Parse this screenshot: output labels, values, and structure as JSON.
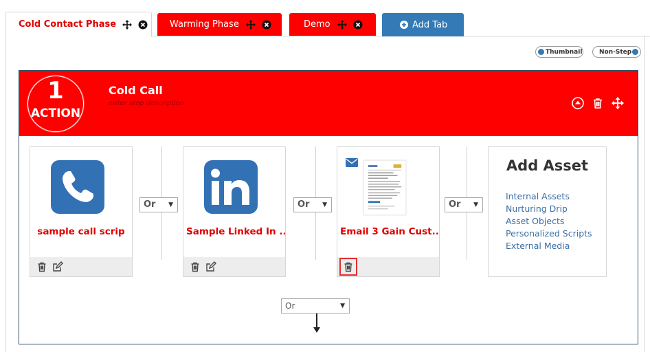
{
  "tabs": [
    {
      "label": "Cold Contact Phase",
      "state": "active"
    },
    {
      "label": "Warming Phase"
    },
    {
      "label": "Demo"
    }
  ],
  "add_tab_label": "Add Tab",
  "toggles": {
    "thumbnail": "Thumbnail",
    "non_step": "Non-Step"
  },
  "step": {
    "number": "1",
    "type": "ACTION",
    "title": "Cold Call",
    "description_placeholder": "enter step description"
  },
  "assets": [
    {
      "name": "sample call scrip",
      "icon": "phone-icon"
    },
    {
      "name": "Sample Linked In ...",
      "icon": "linkedin-icon"
    },
    {
      "name": "Email 3 Gain Cust...",
      "icon": "email-thumbnail"
    }
  ],
  "add_asset": {
    "title": "Add Asset",
    "options": [
      "Internal Assets",
      "Nurturing Drip",
      "Asset Objects",
      "Personalized Scripts",
      "External Media"
    ]
  },
  "or_selects": [
    "Or",
    "Or",
    "Or"
  ],
  "bottom_select": "Or",
  "colors": {
    "brand_red": "#ff0000",
    "primary_blue": "#337ab7",
    "link_blue": "#3a6ea5",
    "frame": "#2d4f68"
  }
}
